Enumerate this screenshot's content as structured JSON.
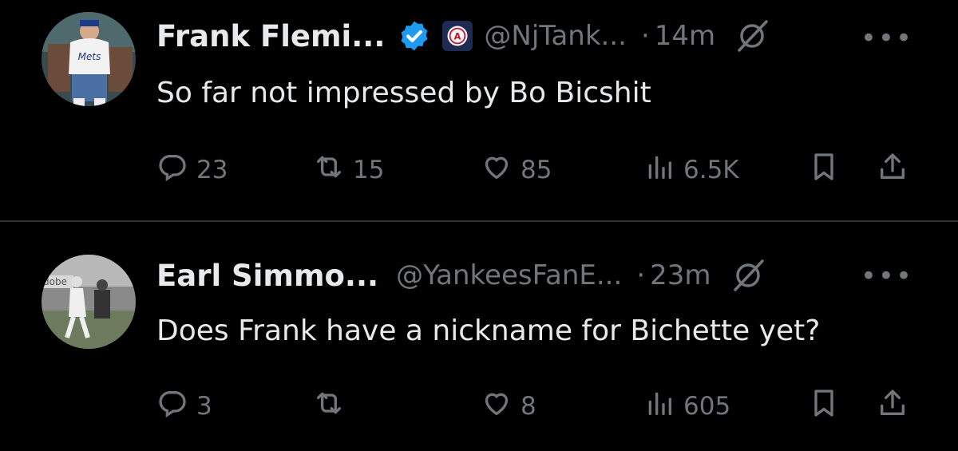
{
  "tweets": [
    {
      "name": "Frank Flemi...",
      "handle": "@NjTank...",
      "separator": "·",
      "time": "14m",
      "verified": true,
      "affiliation_badge": "barstool-logo-icon",
      "text": "So far not impressed by Bo Bicshit",
      "metrics": {
        "replies": "23",
        "reposts": "15",
        "likes": "85",
        "views": "6.5K"
      }
    },
    {
      "name": "Earl Simmo...",
      "handle": "@YankeesFanE...",
      "separator": "·",
      "time": "23m",
      "verified": false,
      "text": "Does Frank have a nickname for Bichette yet?",
      "metrics": {
        "replies": "3",
        "reposts": "",
        "likes": "8",
        "views": "605"
      }
    }
  ],
  "icons": {
    "reply": "reply-icon",
    "repost": "repost-icon",
    "like": "heart-icon",
    "views": "views-chart-icon",
    "bookmark": "bookmark-icon",
    "share": "share-icon",
    "grok": "grok-icon",
    "more": "more-dots-icon"
  },
  "colors": {
    "background": "#000000",
    "text": "#e7e9ea",
    "muted": "#71767b",
    "verified": "#1d9bf0",
    "divider": "#2f3336"
  },
  "more_label": "•••"
}
